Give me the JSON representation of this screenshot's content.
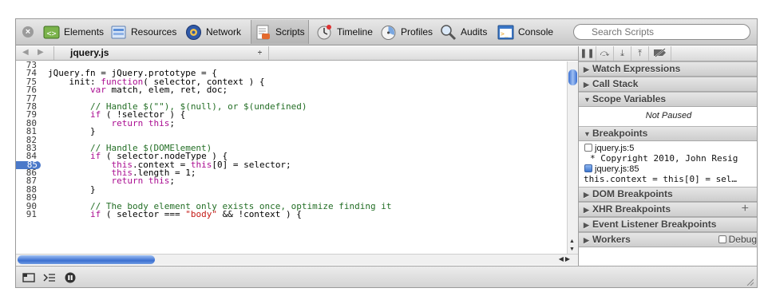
{
  "toolbar": {
    "tabs": [
      {
        "label": "Elements",
        "icon": "elements-icon"
      },
      {
        "label": "Resources",
        "icon": "resources-icon"
      },
      {
        "label": "Network",
        "icon": "network-icon"
      },
      {
        "label": "Scripts",
        "icon": "scripts-icon",
        "active": true
      },
      {
        "label": "Timeline",
        "icon": "timeline-icon"
      },
      {
        "label": "Profiles",
        "icon": "profiles-icon"
      },
      {
        "label": "Audits",
        "icon": "audits-icon"
      },
      {
        "label": "Console",
        "icon": "console-icon"
      }
    ],
    "search_placeholder": "Search Scripts"
  },
  "file_bar": {
    "file_name": "jquery.js",
    "back_glyph": "◀",
    "forward_glyph": "▶",
    "dropdown_glyph": "÷"
  },
  "code": {
    "breakpoint_line": "85",
    "lines": [
      {
        "n": "73",
        "text": ""
      },
      {
        "n": "74",
        "text": "jQuery.fn = jQuery.prototype = {"
      },
      {
        "n": "75",
        "text": "    init: function( selector, context ) {"
      },
      {
        "n": "76",
        "text": "        var match, elem, ret, doc;"
      },
      {
        "n": "77",
        "text": ""
      },
      {
        "n": "78",
        "text": "        // Handle $(\"\"), $(null), or $(undefined)"
      },
      {
        "n": "79",
        "text": "        if ( !selector ) {"
      },
      {
        "n": "80",
        "text": "            return this;"
      },
      {
        "n": "81",
        "text": "        }"
      },
      {
        "n": "82",
        "text": ""
      },
      {
        "n": "83",
        "text": "        // Handle $(DOMElement)"
      },
      {
        "n": "84",
        "text": "        if ( selector.nodeType ) {"
      },
      {
        "n": "85",
        "text": "            this.context = this[0] = selector;"
      },
      {
        "n": "86",
        "text": "            this.length = 1;"
      },
      {
        "n": "87",
        "text": "            return this;"
      },
      {
        "n": "88",
        "text": "        }"
      },
      {
        "n": "89",
        "text": ""
      },
      {
        "n": "90",
        "text": "        // The body element only exists once, optimize finding it"
      },
      {
        "n": "91",
        "text": "        if ( selector === \"body\" && !context ) {"
      }
    ]
  },
  "sidebar": {
    "sections": {
      "watch": "Watch Expressions",
      "callstack": "Call Stack",
      "scope": "Scope Variables",
      "breakpoints": "Breakpoints",
      "dom": "DOM Breakpoints",
      "xhr": "XHR Breakpoints",
      "listeners": "Event Listener Breakpoints",
      "workers": "Workers"
    },
    "not_paused": "Not Paused",
    "breakpoints": [
      {
        "location": "jquery.js:5",
        "code": "* Copyright 2010, John Resig",
        "checked": false
      },
      {
        "location": "jquery.js:85",
        "code": "this.context = this[0] = sel…",
        "checked": true
      }
    ],
    "xhr_add_label": "+",
    "workers_debug_label": "Debug"
  },
  "colors": {
    "breakpoint_blue": "#4b79c9",
    "keyword": "#aa0d91",
    "comment": "#236e25",
    "string": "#c41a16"
  }
}
